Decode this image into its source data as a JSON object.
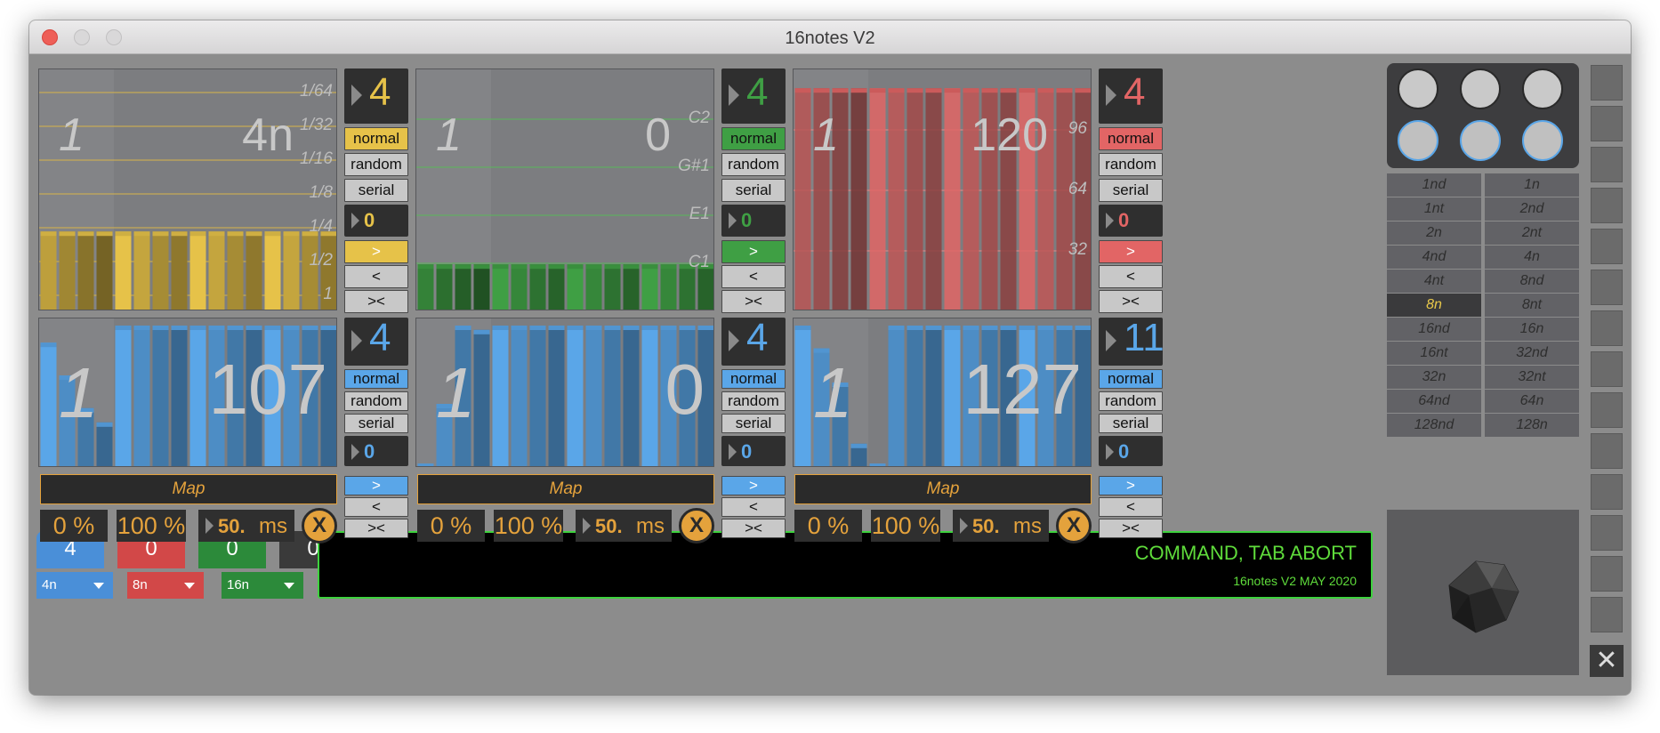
{
  "window": {
    "title": "16notes V2"
  },
  "panels": [
    {
      "id": "duration",
      "index": "1",
      "value": "4n",
      "color": "#e6c249",
      "values": [
        0.34,
        0.34,
        0.34,
        0.34,
        0.34,
        0.34,
        0.34,
        0.34,
        0.34,
        0.34,
        0.34,
        0.34,
        0.34,
        0.34,
        0.34,
        0.34
      ],
      "labels": [
        "1/64",
        "1/32",
        "1/16",
        "1/8",
        "1/4",
        "1/2",
        "1"
      ],
      "steps": "4",
      "mode": "normal",
      "offset": "0"
    },
    {
      "id": "pitch",
      "index": "1",
      "value": "0",
      "color": "#3f9f44",
      "values": [
        0.2,
        0.2,
        0.2,
        0.2,
        0.2,
        0.2,
        0.2,
        0.2,
        0.2,
        0.2,
        0.2,
        0.2,
        0.2,
        0.2,
        0.2,
        0.2
      ],
      "labels": [
        "C2",
        "G#1",
        "E1",
        "C1"
      ],
      "steps": "4",
      "mode": "normal",
      "offset": "0"
    },
    {
      "id": "velocity",
      "index": "1",
      "value": "120",
      "color": "#e26565",
      "values": [
        0.95,
        0.95,
        0.95,
        0.95,
        0.95,
        0.95,
        0.95,
        0.95,
        0.95,
        0.95,
        0.95,
        0.95,
        0.95,
        0.95,
        0.95,
        0.95
      ],
      "labels": [
        "96",
        "64",
        "32"
      ],
      "steps": "4",
      "mode": "normal",
      "offset": "0"
    },
    {
      "id": "cc1",
      "index": "1",
      "value": "107",
      "color": "#5aa6e8",
      "values": [
        0.88,
        0.65,
        0.42,
        0.32,
        1.0,
        1.0,
        1.0,
        1.0,
        1.0,
        1.0,
        1.0,
        1.0,
        1.0,
        1.0,
        1.0,
        1.0
      ],
      "steps": "4",
      "mode": "normal",
      "offset": "0",
      "map": "Map",
      "min": "0 %",
      "max": "100 %",
      "ms_value": "50.",
      "ms_unit": "ms",
      "x": "X"
    },
    {
      "id": "cc2",
      "index": "1",
      "value": "0",
      "color": "#5aa6e8",
      "values": [
        0.03,
        0.45,
        1.0,
        0.97,
        1.0,
        1.0,
        1.0,
        1.0,
        1.0,
        1.0,
        1.0,
        1.0,
        1.0,
        1.0,
        1.0,
        1.0
      ],
      "steps": "4",
      "mode": "normal",
      "offset": "0",
      "map": "Map",
      "min": "0 %",
      "max": "100 %",
      "ms_value": "50.",
      "ms_unit": "ms",
      "x": "X"
    },
    {
      "id": "cc3",
      "index": "1",
      "value": "127",
      "color": "#5aa6e8",
      "values": [
        1.0,
        0.84,
        0.6,
        0.17,
        0.03,
        1.0,
        1.0,
        1.0,
        1.0,
        1.0,
        1.0,
        1.0,
        1.0,
        1.0,
        1.0,
        1.0
      ],
      "steps": "11",
      "mode": "normal",
      "offset": "0",
      "map": "Map",
      "min": "0 %",
      "max": "100 %",
      "ms_value": "50.",
      "ms_unit": "ms",
      "x": "X"
    }
  ],
  "labels": {
    "normal": "normal",
    "random": "random",
    "serial": "serial",
    "fwd": ">",
    "back": "<",
    "both": "><"
  },
  "rates": [
    "1nd",
    "1n",
    "1nt",
    "2nd",
    "2n",
    "2nt",
    "4nd",
    "4n",
    "4nt",
    "8nd",
    "8n",
    "8nt",
    "16nd",
    "16n",
    "16nt",
    "32nd",
    "32n",
    "32nt",
    "64nd",
    "64n",
    "128nd",
    "128n"
  ],
  "active_rate": "8n",
  "counters": [
    {
      "value": "4",
      "color": "#4a8fd8",
      "dd": "4n"
    },
    {
      "value": "0",
      "color": "#d24848",
      "dd": "8n"
    },
    {
      "value": "0",
      "color": "#2c8a3a",
      "dd": "16n"
    },
    {
      "value": "0",
      "color": "#3a3a3a",
      "dd": ""
    }
  ],
  "console": {
    "command": "COMMAND, TAB ABORT",
    "version": "16notes V2 MAY 2020"
  },
  "close": "✕"
}
